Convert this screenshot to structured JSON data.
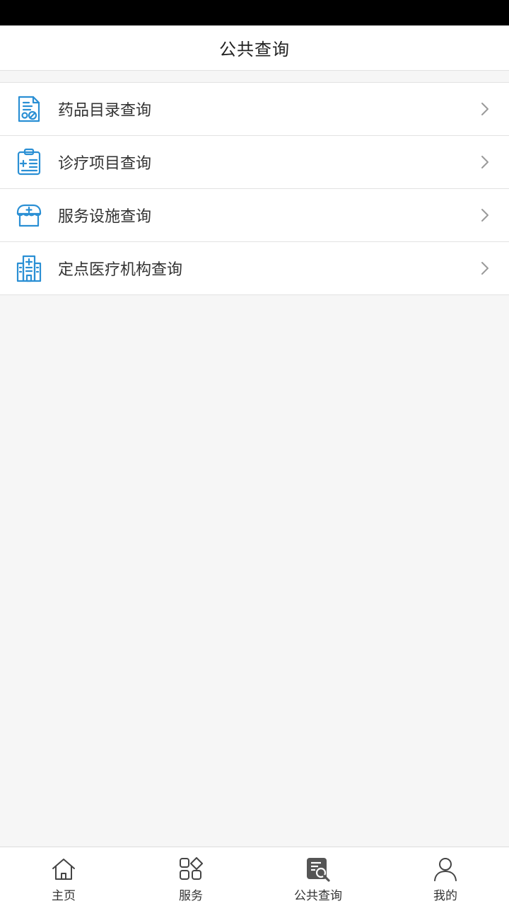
{
  "header": {
    "title": "公共查询"
  },
  "list": {
    "items": [
      {
        "label": "药品目录查询",
        "icon": "medicine-document-icon"
      },
      {
        "label": "诊疗项目查询",
        "icon": "medical-clipboard-icon"
      },
      {
        "label": "服务设施查询",
        "icon": "medical-facility-icon"
      },
      {
        "label": "定点医疗机构查询",
        "icon": "hospital-building-icon"
      }
    ]
  },
  "tabbar": {
    "tabs": [
      {
        "label": "主页",
        "icon": "home-icon",
        "active": false
      },
      {
        "label": "服务",
        "icon": "services-grid-icon",
        "active": false
      },
      {
        "label": "公共查询",
        "icon": "document-search-icon",
        "active": true
      },
      {
        "label": "我的",
        "icon": "user-icon",
        "active": false
      }
    ]
  },
  "colors": {
    "icon_blue": "#2a8fd4",
    "text": "#333333",
    "background": "#f6f6f6"
  }
}
